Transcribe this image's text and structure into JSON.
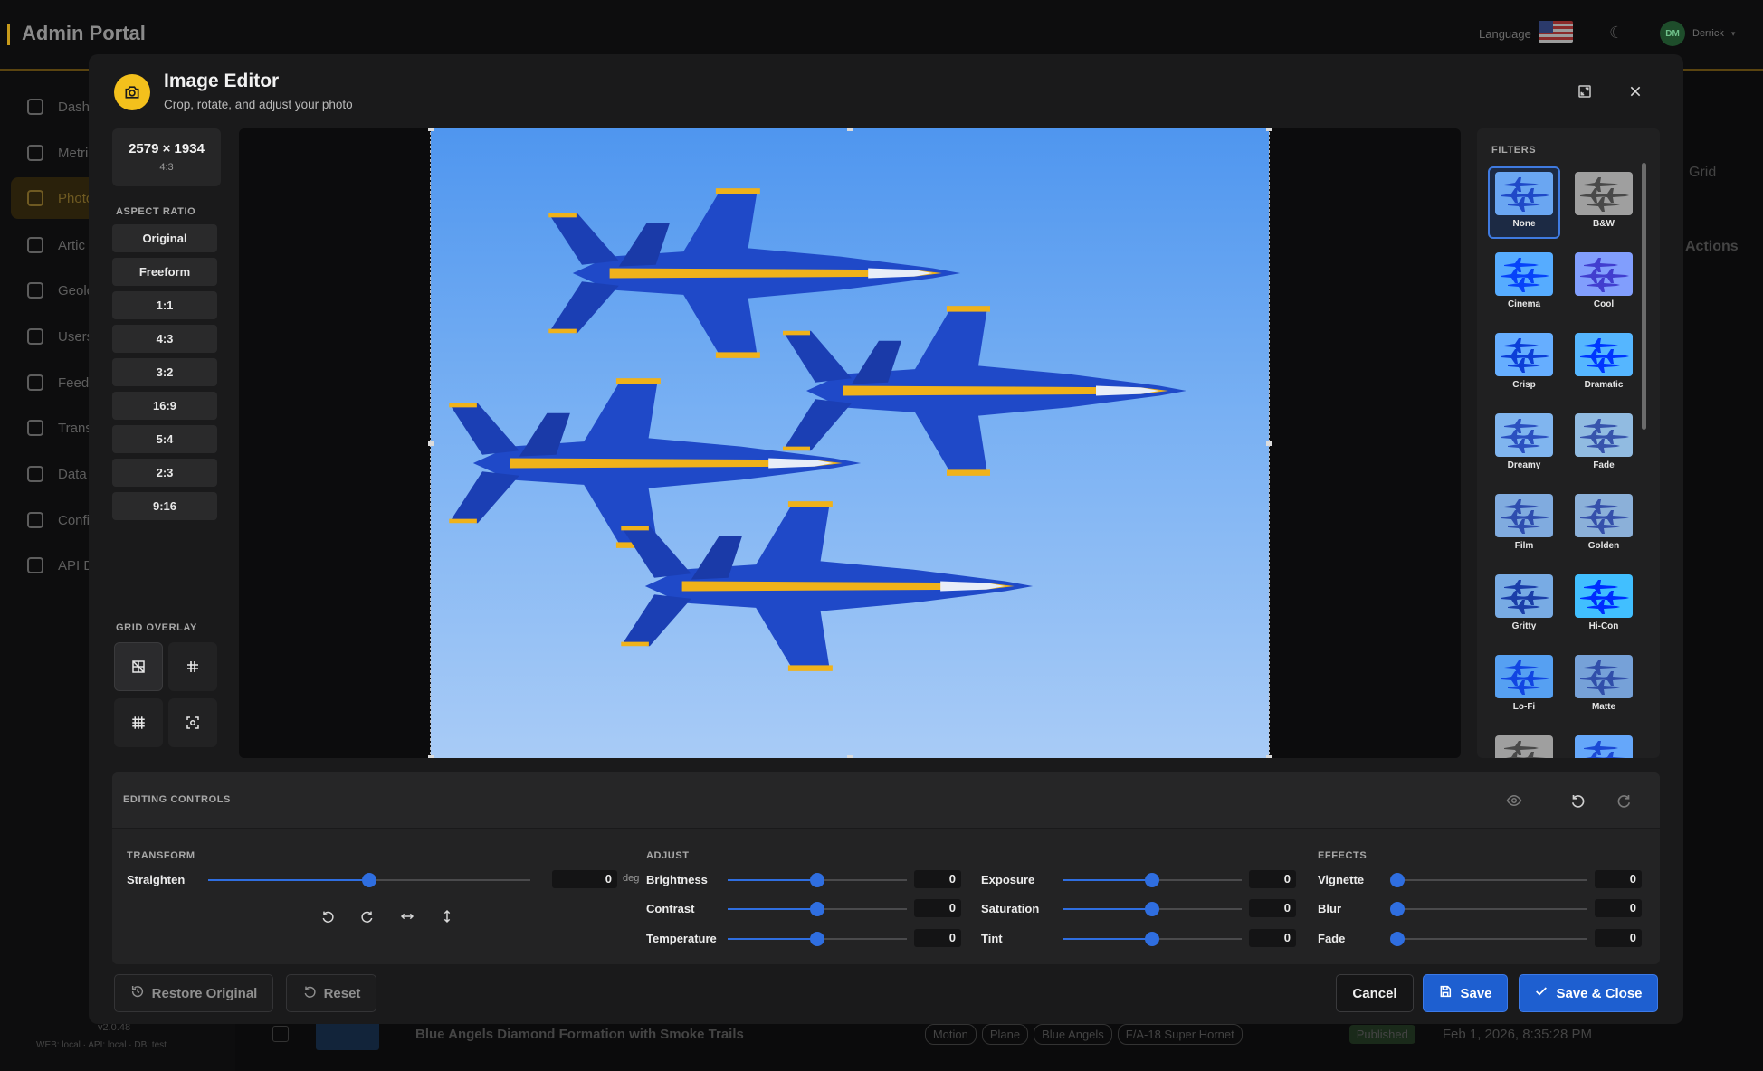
{
  "app": {
    "title": "Admin Portal",
    "language_label": "Language",
    "user_initials": "DM",
    "user_name": "Derrick",
    "version": "v2.0.48",
    "env": "WEB: local · API: local · DB: test"
  },
  "sidebar": {
    "items": [
      {
        "label": "Dash",
        "icon": "home-icon"
      },
      {
        "label": "Metri",
        "icon": "chart-icon"
      },
      {
        "label": "Photo",
        "icon": "image-icon"
      },
      {
        "label": "Artic",
        "icon": "article-icon"
      },
      {
        "label": "Geolo",
        "icon": "pin-icon"
      },
      {
        "label": "Users",
        "icon": "users-icon"
      },
      {
        "label": "Feed",
        "icon": "star-icon"
      },
      {
        "label": "Trans",
        "icon": "translate-icon"
      },
      {
        "label": "Data",
        "icon": "database-icon"
      },
      {
        "label": "Confi",
        "icon": "gear-icon"
      },
      {
        "label": "API D",
        "icon": "doc-icon"
      }
    ]
  },
  "background_page": {
    "grid_label": "Grid",
    "actions_label": "Actions",
    "row": {
      "title": "Blue Angels Diamond Formation with Smoke Trails",
      "tags": [
        "Motion",
        "Plane",
        "Blue Angels",
        "F/A-18 Super Hornet"
      ],
      "status": "Published",
      "date": "Feb 1, 2026, 8:35:28 PM"
    }
  },
  "editor": {
    "title": "Image Editor",
    "subtitle": "Crop, rotate, and adjust your photo",
    "dimensions": "2579 × 1934",
    "dimension_ratio": "4:3",
    "aspect_ratio_label": "ASPECT RATIO",
    "aspect_ratios": [
      "Original",
      "Freeform",
      "1:1",
      "4:3",
      "3:2",
      "16:9",
      "5:4",
      "2:3",
      "9:16"
    ],
    "grid_overlay_label": "GRID OVERLAY",
    "filters_label": "FILTERS",
    "filters": [
      "None",
      "B&W",
      "Cinema",
      "Cool",
      "Crisp",
      "Dramatic",
      "Dreamy",
      "Fade",
      "Film",
      "Golden",
      "Gritty",
      "Hi-Con",
      "Lo-Fi",
      "Matte"
    ],
    "selected_filter": "None",
    "controls_title": "EDITING CONTROLS",
    "transform_label": "TRANSFORM",
    "adjust_label": "ADJUST",
    "effects_label": "EFFECTS",
    "straighten": {
      "label": "Straighten",
      "value": "0",
      "unit": "deg",
      "level": 0.5
    },
    "adjust": [
      {
        "label": "Brightness",
        "value": "0",
        "level": 0.5
      },
      {
        "label": "Contrast",
        "value": "0",
        "level": 0.5
      },
      {
        "label": "Temperature",
        "value": "0",
        "level": 0.5
      },
      {
        "label": "Exposure",
        "value": "0",
        "level": 0.5
      },
      {
        "label": "Saturation",
        "value": "0",
        "level": 0.5
      },
      {
        "label": "Tint",
        "value": "0",
        "level": 0.5
      }
    ],
    "effects": [
      {
        "label": "Vignette",
        "value": "0",
        "level": 0
      },
      {
        "label": "Blur",
        "value": "0",
        "level": 0
      },
      {
        "label": "Fade",
        "value": "0",
        "level": 0
      }
    ],
    "buttons": {
      "restore": "Restore Original",
      "reset": "Reset",
      "cancel": "Cancel",
      "save": "Save",
      "save_close": "Save & Close"
    },
    "colors": {
      "accent": "#f3c01c",
      "primary": "#1e5fd0",
      "slider": "#2f6ee0"
    }
  }
}
